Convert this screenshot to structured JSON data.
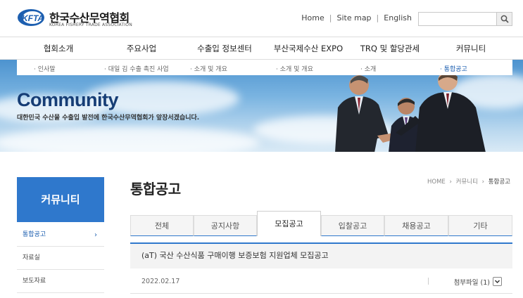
{
  "header": {
    "logo_kr": "한국수산무역협회",
    "logo_en": "KOREA FISHERY TRADE ASSOCIATION",
    "logo_mark": "KFTA",
    "util_links": [
      "Home",
      "Site map",
      "English"
    ],
    "search_placeholder": ""
  },
  "gnb": {
    "items": [
      "협회소개",
      "주요사업",
      "수출입 정보센터",
      "부산국제수산 EXPO",
      "TRQ 및 할당관세",
      "커뮤니티"
    ]
  },
  "subnav": {
    "items": [
      "· 인사말",
      "· 대일 김 수출 촉진 사업",
      "· 소개 및 개요",
      "· 소개 및 개요",
      "· 소개",
      "· 통합공고"
    ]
  },
  "banner": {
    "title": "Community",
    "subtitle": "대한민국 수산물 수출입 발전에 한국수산무역협회가 앞장서겠습니다."
  },
  "side": {
    "title": "커뮤니티",
    "items": [
      {
        "label": "통합공고",
        "arrow": "›"
      },
      {
        "label": "자료실",
        "arrow": ""
      },
      {
        "label": "보도자료",
        "arrow": ""
      }
    ]
  },
  "content": {
    "page_title": "통합공고",
    "breadcrumb": [
      "HOME",
      "커뮤니티",
      "통합공고"
    ],
    "breadcrumb_sep": "›",
    "tabs": [
      "전체",
      "공지사항",
      "모집공고",
      "입찰공고",
      "채용공고",
      "기타"
    ],
    "active_tab": 2,
    "notice": {
      "title": "(aT) 국산 수산식품 구매이행 보증보험 지원업체 모집공고",
      "date": "2022.02.17",
      "attachment_label": "첨부파일 (1)"
    }
  },
  "colors": {
    "brand_blue": "#2f78cc",
    "logo_blue": "#1d5fb0",
    "banner_title": "#163d75"
  },
  "icons": {
    "search": "search-icon",
    "chevron": "chevron-down-icon",
    "arrow": "chevron-right-icon"
  }
}
